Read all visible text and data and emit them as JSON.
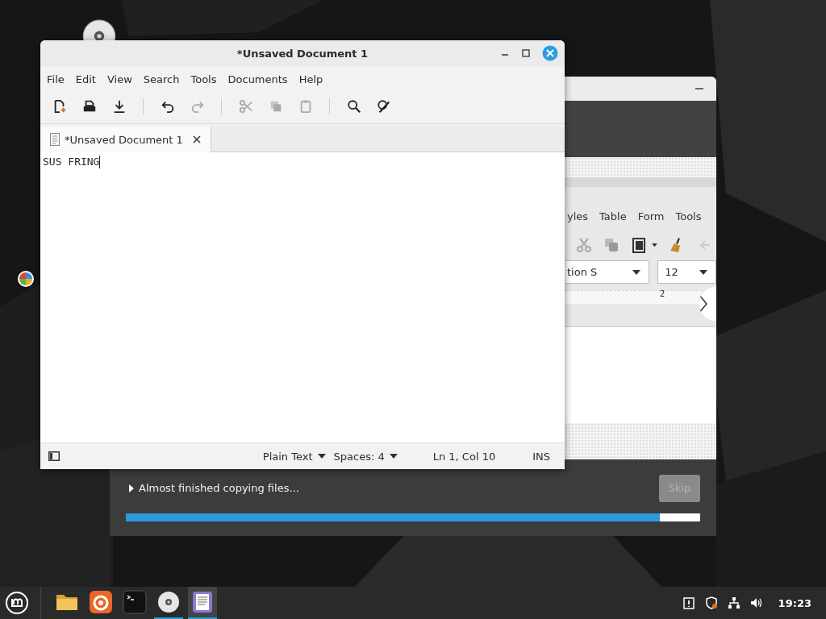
{
  "installer": {
    "slideshow": {
      "menu": [
        "yles",
        "Table",
        "Form",
        "Tools"
      ],
      "font_name": "tion S",
      "font_size": "12",
      "ruler_label": "2"
    },
    "status": "Almost finished copying files...",
    "skip_button": {
      "label": "Skip",
      "disabled": true
    },
    "progress": {
      "level": 0.93
    }
  },
  "editor": {
    "title": "*Unsaved Document 1",
    "menu": [
      "File",
      "Edit",
      "View",
      "Search",
      "Tools",
      "Documents",
      "Help"
    ],
    "toolbar": [
      [
        {
          "kind": "new",
          "disabled": false
        },
        {
          "kind": "open",
          "disabled": false
        },
        {
          "kind": "save",
          "disabled": false
        }
      ],
      [
        {
          "kind": "undo",
          "disabled": false
        },
        {
          "kind": "redo",
          "disabled": true
        }
      ],
      [
        {
          "kind": "cut",
          "disabled": true
        },
        {
          "kind": "copy",
          "disabled": true
        },
        {
          "kind": "paste",
          "disabled": true
        }
      ],
      [
        {
          "kind": "find",
          "disabled": false
        },
        {
          "kind": "replace",
          "disabled": false
        }
      ]
    ],
    "tabs": [
      {
        "label": "*Unsaved Document 1",
        "selected": true
      }
    ],
    "content": "SUS FRING",
    "status_bar": {
      "language": "Plain Text",
      "indent": "Spaces: 4",
      "position": "Ln 1, Col 10",
      "mode": "INS"
    }
  },
  "taskbar": {
    "apps": [
      {
        "kind": "files",
        "running": false,
        "selected": false
      },
      {
        "kind": "browser",
        "running": false,
        "selected": false
      },
      {
        "kind": "terminal",
        "running": false,
        "selected": false
      },
      {
        "kind": "disc",
        "running": true,
        "selected": false
      },
      {
        "kind": "editor",
        "running": true,
        "selected": true
      }
    ],
    "tray": [
      {
        "kind": "notice"
      },
      {
        "kind": "shield"
      },
      {
        "kind": "network"
      },
      {
        "kind": "volume"
      }
    ],
    "clock": "19:23"
  }
}
